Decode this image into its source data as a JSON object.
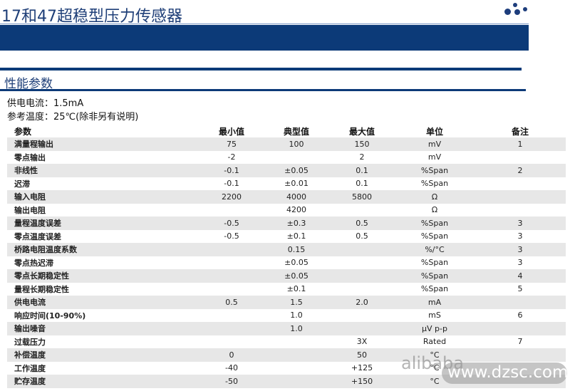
{
  "header": {
    "title": "17和47超稳型压力传感器",
    "brand_color": "#0c3a78"
  },
  "section": {
    "title": "性能参数"
  },
  "conditions": {
    "supply_current": "供电电流：1.5mA",
    "reference_temp": "参考温度：25℃(除非另有说明)"
  },
  "table": {
    "headers": [
      "参数",
      "最小值",
      "典型值",
      "最大值",
      "单位",
      "备注"
    ],
    "rows": [
      [
        "满量程输出",
        "75",
        "100",
        "150",
        "mV",
        "1"
      ],
      [
        "零点输出",
        "-2",
        "",
        "2",
        "mV",
        ""
      ],
      [
        "非线性",
        "-0.1",
        "±0.05",
        "0.1",
        "%Span",
        "2"
      ],
      [
        "迟滞",
        "-0.1",
        "±0.01",
        "0.1",
        "%Span",
        ""
      ],
      [
        "输入电阻",
        "2200",
        "4000",
        "5800",
        "Ω",
        ""
      ],
      [
        "输出电阻",
        "",
        "4200",
        "",
        "Ω",
        ""
      ],
      [
        "量程温度误差",
        "-0.5",
        "±0.3",
        "0.5",
        "%Span",
        "3"
      ],
      [
        "零点温度误差",
        "-0.5",
        "±0.1",
        "0.5",
        "%Span",
        "3"
      ],
      [
        "桥路电阻温度系数",
        "",
        "0.15",
        "",
        "%/°C",
        "3"
      ],
      [
        "零点热迟滞",
        "",
        "±0.05",
        "",
        "%Span",
        "3"
      ],
      [
        "零点长期稳定性",
        "",
        "±0.05",
        "",
        "%Span",
        "4"
      ],
      [
        "量程长期稳定性",
        "",
        "±0.1",
        "",
        "%Span",
        "5"
      ],
      [
        "供电电流",
        "0.5",
        "1.5",
        "2.0",
        "mA",
        ""
      ],
      [
        "响应时间(10-90%)",
        "",
        "1.0",
        "",
        "mS",
        "6"
      ],
      [
        "输出噪音",
        "",
        "1.0",
        "",
        "μV p-p",
        ""
      ],
      [
        "过载压力",
        "",
        "",
        "3X",
        "Rated",
        "7"
      ],
      [
        "补偿温度",
        "0",
        "",
        "50",
        "°C",
        ""
      ],
      [
        "工作温度",
        "-40",
        "",
        "+125",
        "°C",
        ""
      ],
      [
        "贮存温度",
        "-50",
        "",
        "+150",
        "°C",
        ""
      ]
    ]
  },
  "watermark": {
    "text": "alibaba",
    "url": "www.dzsc.com"
  }
}
